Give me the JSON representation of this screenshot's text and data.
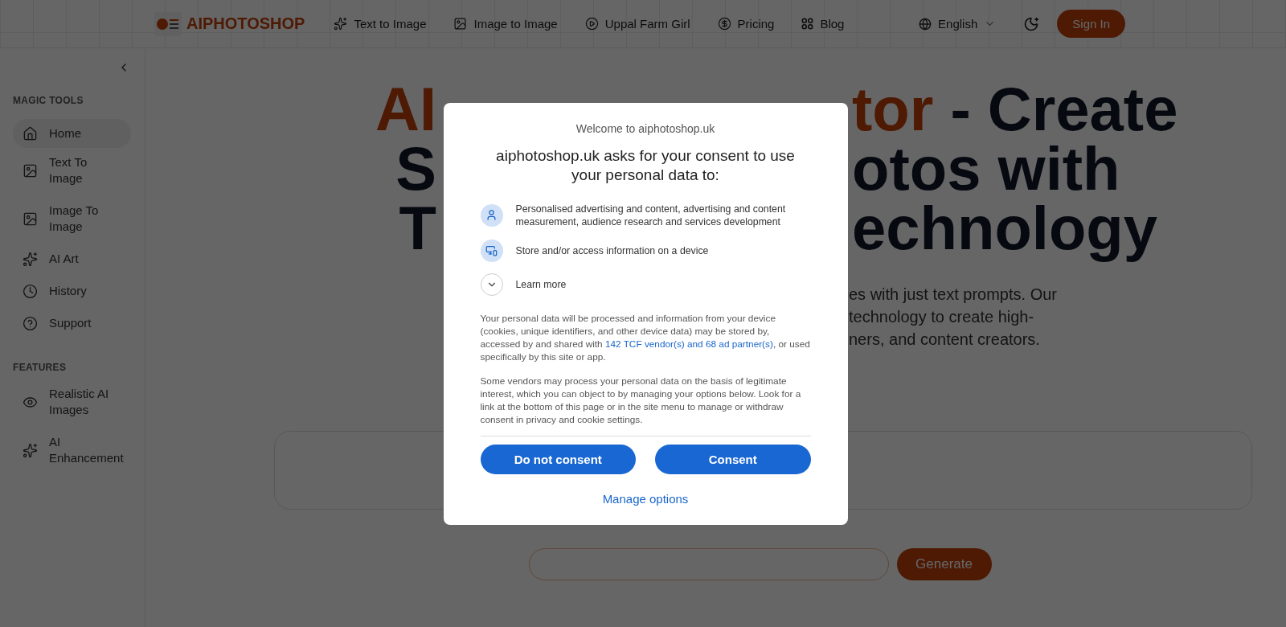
{
  "header": {
    "brand": "AIPHOTOSHOP",
    "nav": [
      {
        "label": "Text to Image",
        "kind": "sparkles"
      },
      {
        "label": "Image to Image",
        "kind": "image"
      },
      {
        "label": "Uppal Farm Girl",
        "kind": "play"
      },
      {
        "label": "Pricing",
        "kind": "dollar"
      },
      {
        "label": "Blog",
        "kind": "dots"
      }
    ],
    "language": "English",
    "sign_in": "Sign In"
  },
  "sidebar": {
    "sections": [
      {
        "title": "MAGIC TOOLS",
        "items": [
          {
            "label": "Home",
            "kind": "home",
            "selected": true
          },
          {
            "label": "Text To Image",
            "kind": "image",
            "selected": false
          },
          {
            "label": "Image To Image",
            "kind": "image",
            "selected": false
          },
          {
            "label": "AI Art",
            "kind": "sparkles",
            "selected": false
          },
          {
            "label": "History",
            "kind": "clock",
            "selected": false
          },
          {
            "label": "Support",
            "kind": "help",
            "selected": false
          }
        ]
      },
      {
        "title": "FEATURES",
        "items": [
          {
            "label": "Realistic AI Images",
            "kind": "eye",
            "selected": false
          },
          {
            "label": "AI Enhancement",
            "kind": "sparkles",
            "selected": false
          }
        ]
      }
    ]
  },
  "hero": {
    "heading_lines": [
      {
        "left": "AI",
        "right_accent": "tor",
        "right": " - Create"
      },
      {
        "left": "S",
        "right": "otos with"
      },
      {
        "left": "T",
        "right": "echnology"
      }
    ],
    "subtitle_lines": [
      "es with just text prompts. Our",
      "technology to create high-",
      "ners, and content creators."
    ],
    "generate_button": "Generate"
  },
  "consent_dialog": {
    "welcome": "Welcome to aiphotoshop.uk",
    "title": "aiphotoshop.uk asks for your consent to use your personal data to:",
    "purposes": [
      {
        "kind": "person",
        "text": "Personalised advertising and content, advertising and content measurement, audience research and services development"
      },
      {
        "kind": "devices",
        "text": "Store and/or access information on a device"
      }
    ],
    "learn_more": {
      "label": "Learn more",
      "expanded": false
    },
    "paragraph_1": {
      "before": "Your personal data will be processed and information from your device (cookies, unique identifiers, and other device data) may be stored by, accessed by and shared with ",
      "link": "142 TCF vendor(s) and 68 ad partner(s)",
      "after": ", or used specifically by this site or app."
    },
    "paragraph_2": "Some vendors may process your personal data on the basis of legitimate interest, which you can object to by managing your options below. Look for a link at the bottom of this page or in the site menu to manage or withdraw consent in privacy and cookie settings.",
    "buttons": [
      "Do not consent",
      "Consent"
    ],
    "manage_options": "Manage options"
  }
}
